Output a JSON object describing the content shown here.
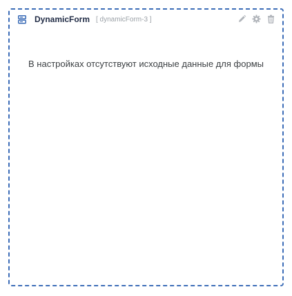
{
  "widget": {
    "title": "DynamicForm",
    "subtitle": "[ dynamicForm-3 ]",
    "message": "В настройках отсутствуют исходные данные для формы",
    "icons": {
      "form": "form-icon",
      "edit": "pencil-icon",
      "settings": "gear-icon",
      "delete": "trash-icon"
    }
  },
  "colors": {
    "border": "#3b6cb7",
    "title": "#1f2a44",
    "icon_gray": "#b0b4ba",
    "form_icon": "#3b6cb7"
  }
}
